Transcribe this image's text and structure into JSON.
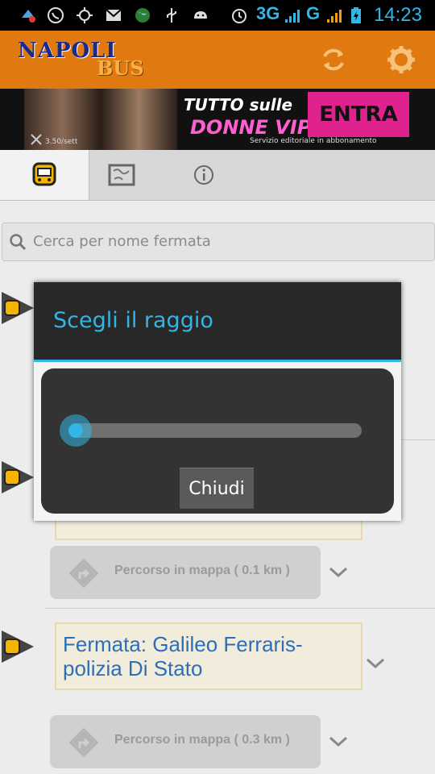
{
  "status_bar": {
    "network_3g": "3G",
    "network_g": "G",
    "time": "14:23",
    "icons": [
      "app-notification-icon",
      "whatsapp-icon",
      "gps-icon",
      "gmail-icon",
      "globe-icon",
      "usb-icon",
      "android-icon",
      "alarm-icon",
      "signal-icon",
      "battery-charging-icon"
    ]
  },
  "app_header": {
    "logo_line1": "NAPOLI",
    "logo_line2": "BUS",
    "refresh_icon": "refresh-icon",
    "settings_icon": "gear-icon"
  },
  "banner": {
    "headline": "TUTTO sulle",
    "highlight": "DONNE VIP!",
    "cta": "ENTRA",
    "subtitle": "Servizio editoriale in abbonamento",
    "price": "3.50/sett"
  },
  "tabs": [
    {
      "icon": "bus-icon",
      "active": true
    },
    {
      "icon": "map-icon",
      "active": false
    },
    {
      "icon": "info-icon",
      "active": false
    }
  ],
  "search": {
    "placeholder": "Cerca per nome fermata"
  },
  "list": {
    "stops": [
      {
        "route_label": "Percorso in mappa ( 0.1 km )"
      },
      {
        "title": "Fermata: Galileo Ferraris-polizia Di Stato",
        "route_label": "Percorso in mappa ( 0.3 km )"
      }
    ]
  },
  "dialog": {
    "title": "Scegli il raggio",
    "slider_value": 0.02,
    "close_label": "Chiudi"
  },
  "colors": {
    "accent": "#33b5e5",
    "header": "#e07a10",
    "stop_title": "#2a6fb8"
  }
}
